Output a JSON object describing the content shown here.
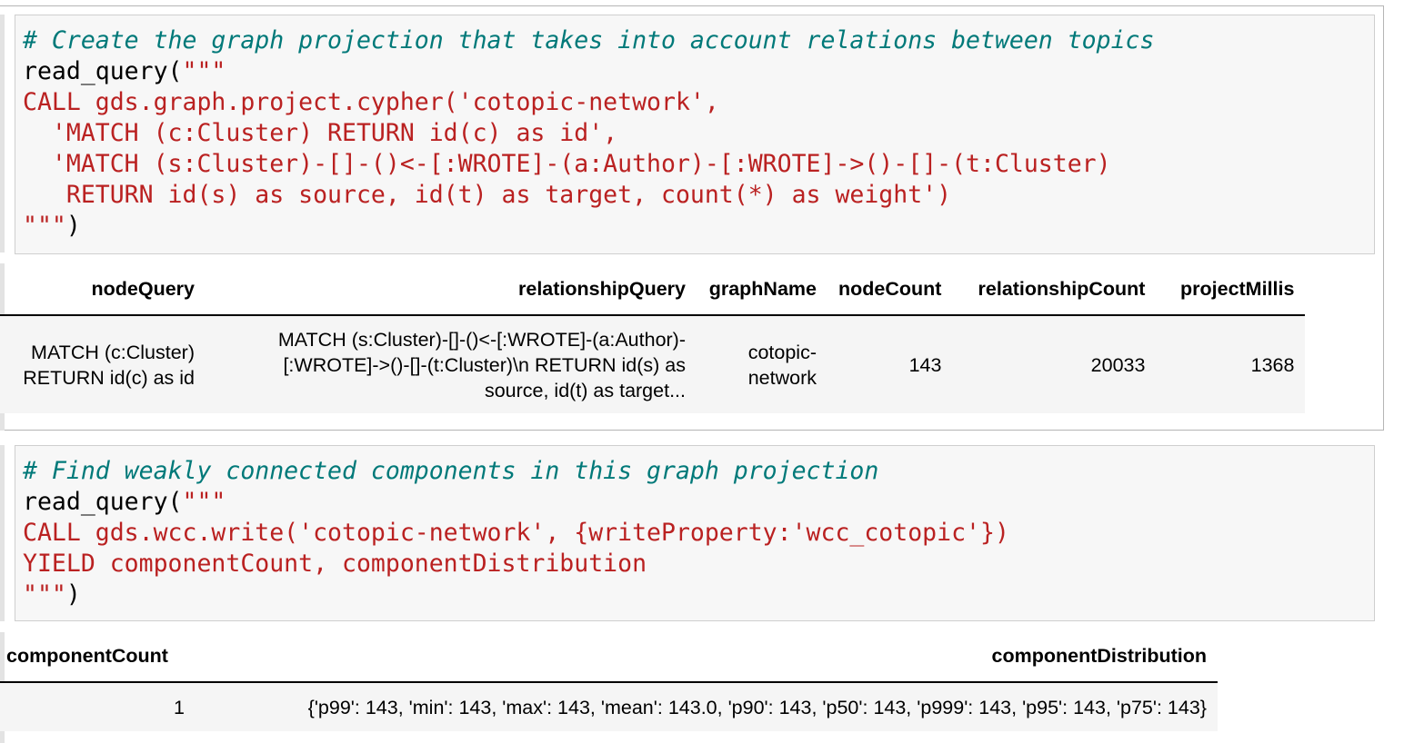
{
  "cell1": {
    "code": [
      [
        {
          "t": "c",
          "v": "# Create the graph projection that takes into account relations between topics"
        }
      ],
      [
        {
          "t": "p",
          "v": "read_query("
        },
        {
          "t": "s",
          "v": "\"\"\""
        }
      ],
      [
        {
          "t": "s",
          "v": "CALL gds.graph.project.cypher('cotopic-network',"
        }
      ],
      [
        {
          "t": "s",
          "v": "  'MATCH (c:Cluster) RETURN id(c) as id',"
        }
      ],
      [
        {
          "t": "s",
          "v": "  'MATCH (s:Cluster)-[]-()<-[:WROTE]-(a:Author)-[:WROTE]->()-[]-(t:Cluster)"
        }
      ],
      [
        {
          "t": "s",
          "v": "   RETURN id(s) as source, id(t) as target, count(*) as weight')"
        }
      ],
      [
        {
          "t": "s",
          "v": "\"\"\""
        },
        {
          "t": "p",
          "v": ")"
        }
      ]
    ],
    "table": {
      "headers": [
        "nodeQuery",
        "relationshipQuery",
        "graphName",
        "nodeCount",
        "relationshipCount",
        "projectMillis"
      ],
      "row": {
        "nodeQuery": [
          "MATCH (c:Cluster)",
          "RETURN id(c) as id"
        ],
        "relationshipQuery": [
          "MATCH (s:Cluster)-[]-()<-[:WROTE]-(a:Author)-",
          "[:WROTE]->()-[]-(t:Cluster)\\n RETURN id(s) as",
          "source, id(t) as target..."
        ],
        "graphName": [
          "cotopic-",
          "network"
        ],
        "nodeCount": "143",
        "relationshipCount": "20033",
        "projectMillis": "1368"
      }
    }
  },
  "cell2": {
    "code": [
      [
        {
          "t": "c",
          "v": "# Find weakly connected components in this graph projection"
        }
      ],
      [
        {
          "t": "p",
          "v": "read_query("
        },
        {
          "t": "s",
          "v": "\"\"\""
        }
      ],
      [
        {
          "t": "s",
          "v": "CALL gds.wcc.write('cotopic-network', {writeProperty:'wcc_cotopic'})"
        }
      ],
      [
        {
          "t": "s",
          "v": "YIELD componentCount, componentDistribution"
        }
      ],
      [
        {
          "t": "s",
          "v": "\"\"\""
        },
        {
          "t": "p",
          "v": ")"
        }
      ]
    ],
    "table": {
      "headers": [
        "componentCount",
        "componentDistribution"
      ],
      "row": {
        "componentCount": "1",
        "componentDistribution": "{'p99': 143, 'min': 143, 'max': 143, 'mean': 143.0, 'p90': 143, 'p50': 143, 'p999': 143, 'p95': 143, 'p75': 143}"
      }
    }
  }
}
